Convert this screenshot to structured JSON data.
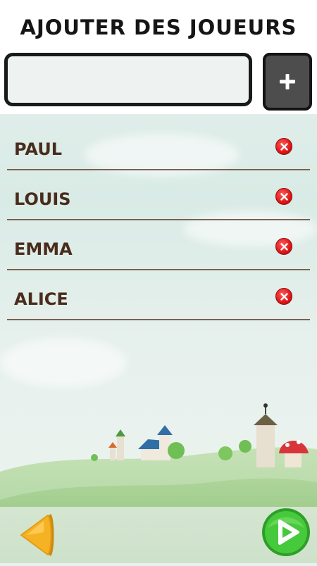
{
  "header": {
    "title": "AJOUTER DES JOUEURS",
    "name_input": {
      "value": "",
      "placeholder": ""
    },
    "add_button_icon": "plus-icon"
  },
  "players": [
    {
      "name": "PAUL",
      "remove_icon": "close-icon"
    },
    {
      "name": "LOUIS",
      "remove_icon": "close-icon"
    },
    {
      "name": "EMMA",
      "remove_icon": "close-icon"
    },
    {
      "name": "ALICE",
      "remove_icon": "close-icon"
    }
  ],
  "footer": {
    "back_icon": "arrow-left-icon",
    "play_icon": "play-icon"
  },
  "colors": {
    "title": "#151515",
    "player_name": "#4a2c1c",
    "divider": "#7b6152",
    "add_button": "#4d4d4d",
    "remove_button": "#e01515",
    "back_button": "#f5b324",
    "play_button": "#3dbf33"
  }
}
